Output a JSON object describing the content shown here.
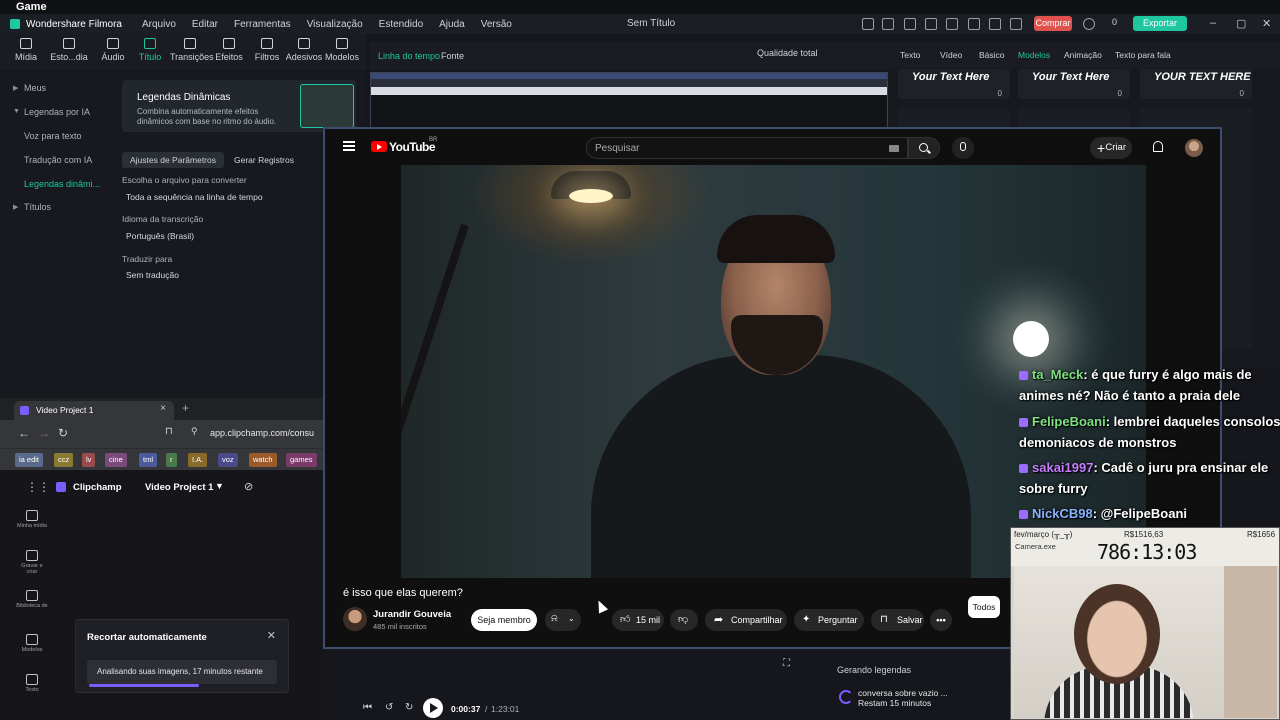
{
  "os": {
    "title": "Game"
  },
  "filmora": {
    "app_name": "Wondershare Filmora",
    "menus": [
      "Arquivo",
      "Editar",
      "Ferramentas",
      "Visualização",
      "Estendido",
      "Ajuda",
      "Versão"
    ],
    "doc_title": "Sem Título",
    "buy_label": "Comprar",
    "export_label": "Exportar",
    "credits": "0",
    "tools": [
      "Mídia",
      "Esto...dia",
      "Áudio",
      "Título",
      "Transições",
      "Efeitos",
      "Filtros",
      "Adesivos",
      "Modelos"
    ],
    "nav": [
      "Meus",
      "Legendas por IA",
      "Voz para texto",
      "Tradução com IA",
      "Legendas dinâmi...",
      "Títulos"
    ],
    "card": {
      "title": "Legendas Dinâmicas",
      "desc": "Combina automaticamente efeitos dinâmicos com base no ritmo do áudio."
    },
    "param_tabs": [
      "Ajustes de Parâmetros",
      "Gerar Registros"
    ],
    "params": [
      {
        "label": "Escolha o arquivo para converter",
        "value": "Toda a sequência na linha de tempo"
      },
      {
        "label": "Idioma da transcrição",
        "value": "Português (Brasil)"
      },
      {
        "label": "Traduzir para",
        "value": "Sem tradução"
      }
    ],
    "timeline_tabs": [
      "Linha do tempo",
      "Fonte"
    ],
    "quality": "Qualidade total",
    "right_tabs": [
      "Texto",
      "Vídeo",
      "Básico",
      "Modelos",
      "Animação",
      "Texto para fala"
    ],
    "templates": [
      {
        "text": "Your Text Here",
        "count": "0"
      },
      {
        "text": "Your Text Here",
        "count": "0"
      },
      {
        "text": "YOUR TEXT HERE",
        "count": "0"
      }
    ]
  },
  "youtube": {
    "logo_text": "YouTube",
    "logo_sup": "BR",
    "search_placeholder": "Pesquisar",
    "create_label": "Criar",
    "video_title": "é isso que elas querem?",
    "channel": "Jurandir Gouveia",
    "subs": "485 mil inscritos",
    "join_label": "Seja membro",
    "likes": "15 mil",
    "share_label": "Compartilhar",
    "ask_label": "Perguntar",
    "save_label": "Salvar",
    "more_label": "•••",
    "todos_label": "Todos"
  },
  "chat": [
    {
      "user": "ta_Meck",
      "text": ": é que furry é algo mais de animes né? Não é tanto a praia dele"
    },
    {
      "user": "FelipeBoani",
      "text": ": lembrei daqueles consolos demoniacos de monstros"
    },
    {
      "user": "sakai1997",
      "text": ": Cadê o juru pra ensinar ele sobre furry"
    },
    {
      "user": "NickCB98",
      "text": ": @FelipeBoani"
    }
  ],
  "clipchamp": {
    "tab_title": "Video Project 1",
    "url": "app.clipchamp.com/consu",
    "bookmarks": [
      "ia edit",
      "ccz",
      "lv",
      "cine",
      "tml",
      "r",
      "I.A.",
      "voz",
      "watch",
      "games"
    ],
    "app_name": "Clipchamp",
    "project_name": "Video Project 1",
    "side": [
      "Minha mídia",
      "Gravar e criar",
      "Biblioteca de",
      "Modelos",
      "Texto"
    ],
    "auto_title": "Recortar automaticamente",
    "auto_status": "Analisando suas imagens, 17 minutos restante",
    "auto_progress": 0.58
  },
  "player": {
    "current": "0:00:37",
    "total": "1:23:01"
  },
  "generating": {
    "title": "Gerando legendas",
    "line1": "conversa sobre vazio ...",
    "line2": "Restam 15 minutos"
  },
  "cam": {
    "date": "fev/março",
    "date_sub": "(╥_╥)",
    "r1": "R$1516,63",
    "r2": "R$1656",
    "clock": "786:13:03",
    "caption": "Camera.exe"
  }
}
